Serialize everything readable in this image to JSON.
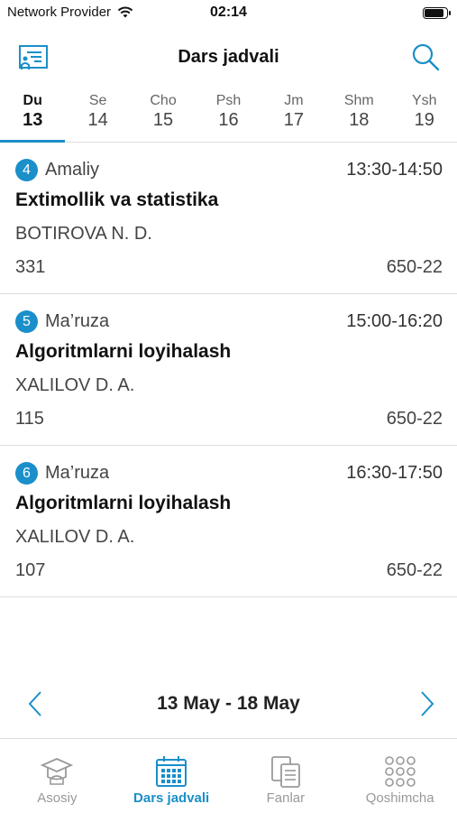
{
  "status": {
    "carrier": "Network Provider",
    "time": "02:14",
    "battery_level": 0.9
  },
  "header": {
    "title": "Dars jadvali",
    "left_icon": "schedule-board-icon",
    "right_icon": "search-icon"
  },
  "colors": {
    "accent": "#1a8fc9",
    "text": "#222222",
    "muted": "#999999",
    "divider": "#dddddd"
  },
  "days": [
    {
      "name": "Du",
      "num": "13",
      "active": true
    },
    {
      "name": "Se",
      "num": "14"
    },
    {
      "name": "Cho",
      "num": "15"
    },
    {
      "name": "Psh",
      "num": "16"
    },
    {
      "name": "Jm",
      "num": "17"
    },
    {
      "name": "Shm",
      "num": "18"
    },
    {
      "name": "Ysh",
      "num": "19"
    }
  ],
  "lessons": [
    {
      "num": "4",
      "type": "Amaliy",
      "time": "13:30-14:50",
      "subject": "Extimollik va statistika",
      "teacher": "BOTIROVA N. D.",
      "room": "331",
      "group": "650-22"
    },
    {
      "num": "5",
      "type": "Ma’ruza",
      "time": "15:00-16:20",
      "subject": "Algoritmlarni loyihalash",
      "teacher": "XALILOV D. A.",
      "room": "115",
      "group": "650-22"
    },
    {
      "num": "6",
      "type": "Ma’ruza",
      "time": "16:30-17:50",
      "subject": "Algoritmlarni loyihalash",
      "teacher": "XALILOV D. A.",
      "room": "107",
      "group": "650-22"
    }
  ],
  "week_nav": {
    "range": "13 May - 18 May",
    "prev_icon": "chevron-left-icon",
    "next_icon": "chevron-right-icon"
  },
  "tabs": [
    {
      "label": "Asosiy",
      "icon": "graduation-cap-icon"
    },
    {
      "label": "Dars jadvali",
      "icon": "calendar-icon",
      "active": true
    },
    {
      "label": "Fanlar",
      "icon": "books-icon"
    },
    {
      "label": "Qoshimcha",
      "icon": "grid-dots-icon"
    }
  ]
}
